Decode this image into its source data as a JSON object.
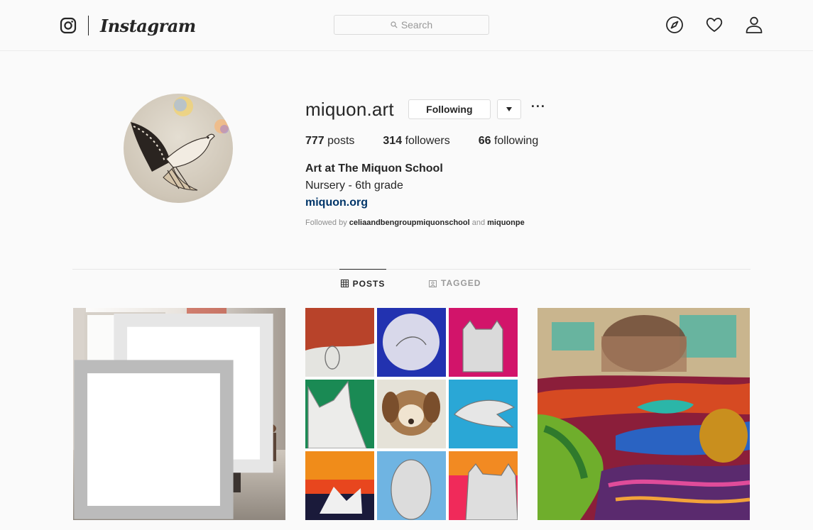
{
  "header": {
    "brand": "Instagram",
    "search_placeholder": "Search",
    "icons": [
      "instagram-glyph-icon",
      "explore-compass-icon",
      "activity-heart-icon",
      "profile-person-icon"
    ]
  },
  "profile": {
    "username": "miquon.art",
    "following_button": "Following",
    "more_label": "···",
    "stats": {
      "posts_count": "777",
      "posts_label": "posts",
      "followers_count": "314",
      "followers_label": "followers",
      "following_count": "66",
      "following_label": "following"
    },
    "full_name": "Art at The Miquon School",
    "bio": "Nursery - 6th grade",
    "website": "miquon.org",
    "followed_by_prefix": "Followed by",
    "followed_by_user1": "celiaandbengroupmiquonschool",
    "followed_by_and": "and",
    "followed_by_user2": "miquonpe"
  },
  "tabs": [
    {
      "label": "POSTS",
      "icon": "grid-icon",
      "active": true
    },
    {
      "label": "TAGGED",
      "icon": "tagged-icon",
      "active": false
    }
  ],
  "posts": [
    {
      "description_icon": "photo-children-loom",
      "multi": true
    },
    {
      "description_icon": "photo-animal-drawings-collage",
      "multi": false
    },
    {
      "description_icon": "photo-woven-tapestry",
      "multi": false
    }
  ],
  "colors": {
    "text": "#262626",
    "muted": "#8e8e8e",
    "link": "#003569",
    "border": "#dbdbdb",
    "background": "#fafafa"
  }
}
